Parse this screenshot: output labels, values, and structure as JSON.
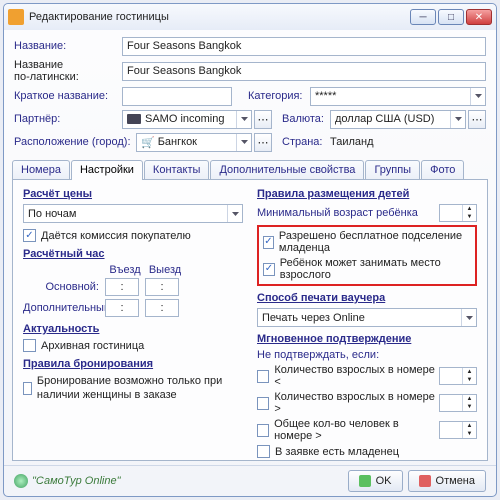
{
  "title": "Редактирование гостиницы",
  "top": {
    "name_l": "Название:",
    "name_v": "Four Seasons Bangkok",
    "latin_l1": "Название",
    "latin_l2": "по-латински:",
    "latin_v": "Four Seasons Bangkok",
    "short_l": "Краткое название:",
    "cat_l": "Категория:",
    "cat_v": "*****",
    "partner_l": "Партнёр:",
    "partner_v": "SAMO incoming",
    "cur_l": "Валюта:",
    "cur_v": "доллар США (USD)",
    "loc_l": "Расположение (город):",
    "loc_v": "Бангкок",
    "country_l": "Страна:",
    "country_v": "Таиланд"
  },
  "tabs": [
    "Номера",
    "Настройки",
    "Контакты",
    "Дополнительные свойства",
    "Группы",
    "Фото"
  ],
  "active_tab": 1,
  "left": {
    "g1": "Расчёт цены",
    "by_nights": "По ночам",
    "commission": "Даётся комиссия покупателю",
    "g2": "Расчётный час",
    "in": "Въезд",
    "out": "Выезд",
    "main": "Основной:",
    "extra": "Дополнительный:",
    "colon": ":",
    "g3": "Актуальность",
    "arch": "Архивная гостиница",
    "g4": "Правила бронирования",
    "women": "Бронирование возможно только при наличии женщины в заказе"
  },
  "right": {
    "g1": "Правила размещения детей",
    "minage": "Минимальный возраст ребёнка",
    "infant": "Разрешено бесплатное подселение младенца",
    "adult": "Ребёнок может занимать место взрослого",
    "g2": "Способ печати ваучера",
    "voucher": "Печать через Online",
    "g3": "Мгновенное подтверждение",
    "noconf": "Не подтверждать, если:",
    "c1": "Количество взрослых в номере <",
    "c2": "Количество взрослых в номере >",
    "c3": "Общее кол-во человек в номере >",
    "c4": "В заявке есть младенец"
  },
  "footer": {
    "brand": "\"СамоТур Online\"",
    "ok": "OK",
    "cancel": "Отмена"
  }
}
